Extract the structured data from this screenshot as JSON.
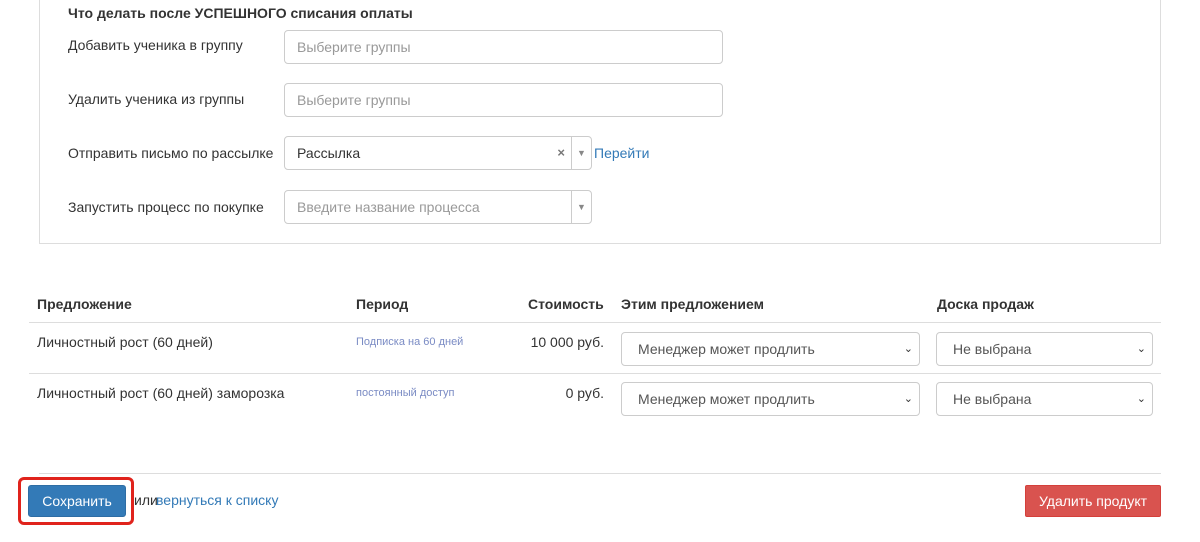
{
  "section": {
    "title": "Что делать после УСПЕШНОГО списания оплаты",
    "add_to_group": {
      "label": "Добавить ученика в группу",
      "placeholder": "Выберите группы"
    },
    "remove_from_group": {
      "label": "Удалить ученика из группы",
      "placeholder": "Выберите группы"
    },
    "send_mail": {
      "label": "Отправить письмо по рассылке",
      "value": "Рассылка",
      "clear": "×",
      "goto": "Перейти"
    },
    "start_process": {
      "label": "Запустить процесс по покупке",
      "placeholder": "Введите название процесса"
    }
  },
  "table": {
    "headers": [
      "Предложение",
      "Период",
      "Стоимость",
      "Этим предложением",
      "Доска продаж"
    ],
    "rows": [
      {
        "offer": "Личностный рост (60 дней)",
        "period": "Подписка на 60 дней",
        "price": "10 000 руб.",
        "action": "Менеджер может продлить",
        "board": "Не выбрана"
      },
      {
        "offer": "Личностный рост (60 дней) заморозка",
        "period": "постоянный доступ",
        "price": "0 руб.",
        "action": "Менеджер может продлить",
        "board": "Не выбрана"
      }
    ]
  },
  "footer": {
    "save_label": "Сохранить",
    "or_text": "или",
    "back_link": "вернуться к списку",
    "delete_label": "Удалить продукт"
  },
  "colors": {
    "primary": "#337ab7",
    "danger": "#d9534f",
    "highlight": "#e0231c"
  }
}
